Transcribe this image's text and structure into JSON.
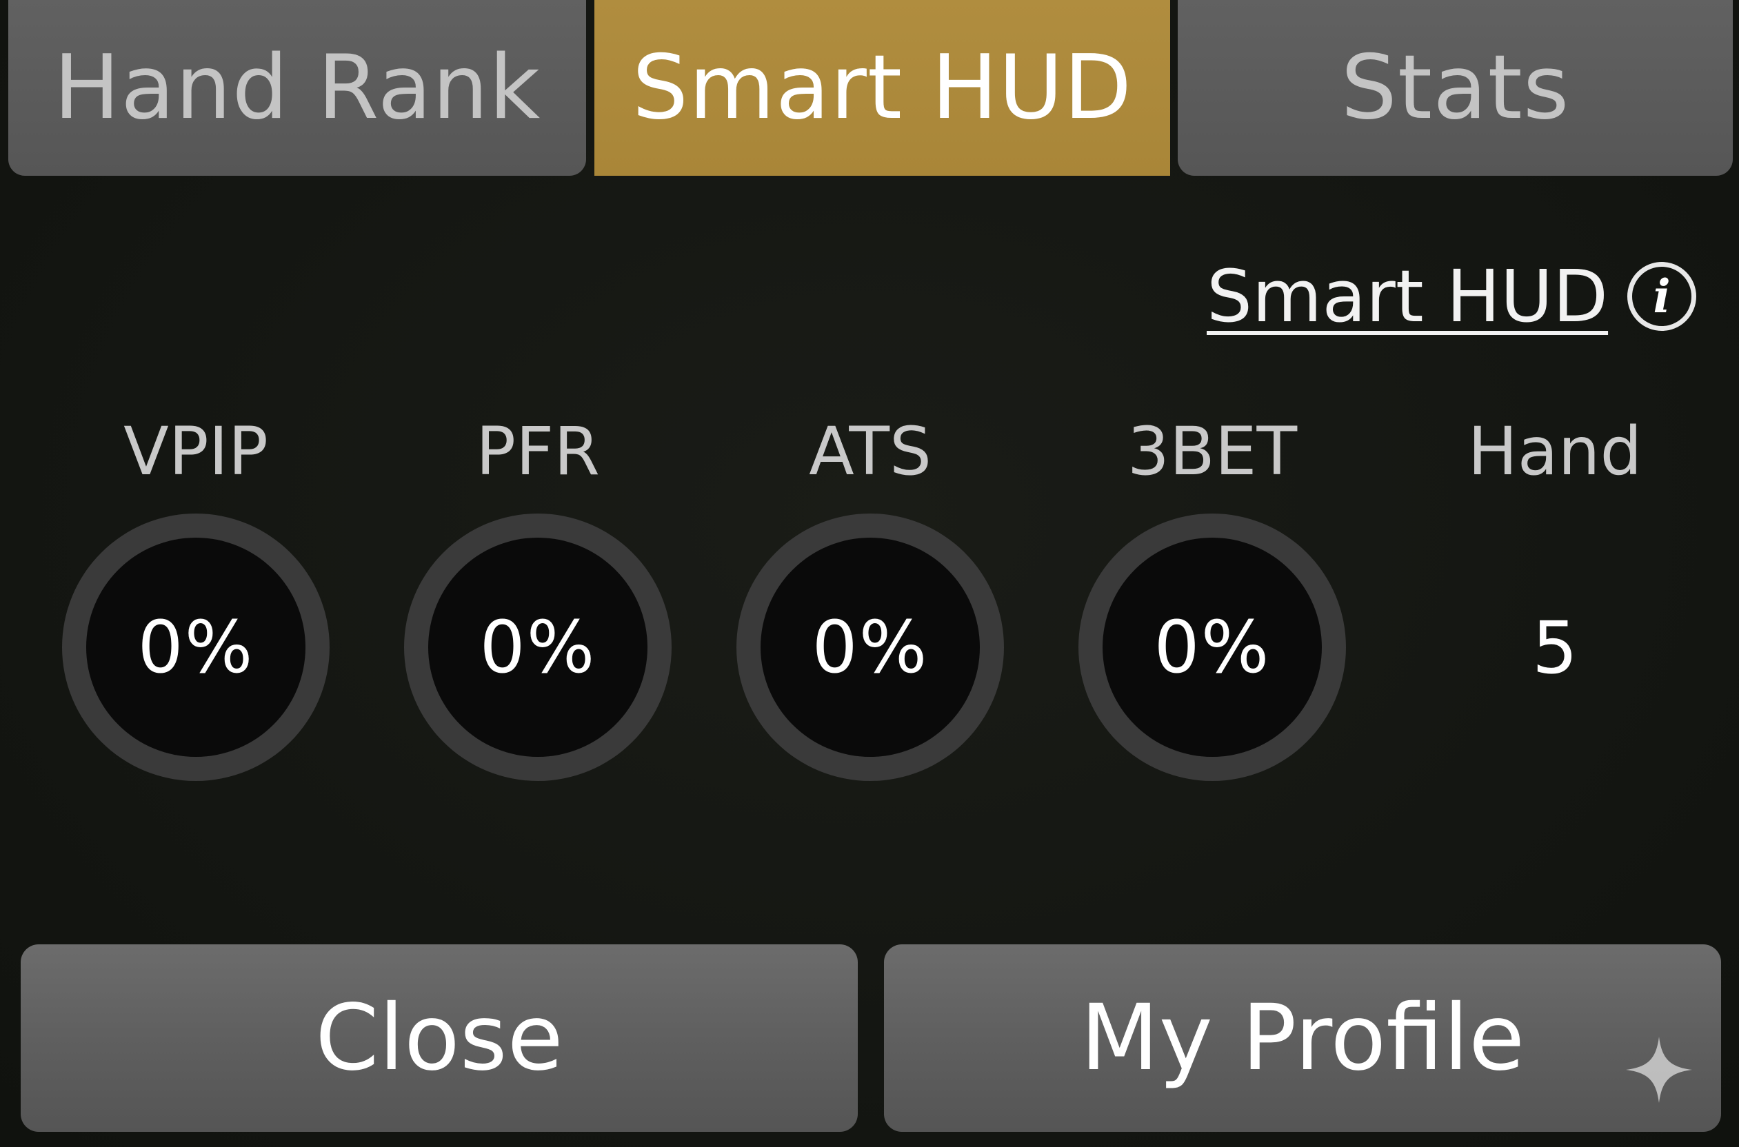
{
  "tabs": [
    {
      "label": "Hand Rank",
      "active": false
    },
    {
      "label": "Smart HUD",
      "active": true
    },
    {
      "label": "Stats",
      "active": false
    }
  ],
  "hud_link": {
    "label": "Smart HUD",
    "icon": "info-icon"
  },
  "stats": [
    {
      "label": "VPIP",
      "value": "0%"
    },
    {
      "label": "PFR",
      "value": "0%"
    },
    {
      "label": "ATS",
      "value": "0%"
    },
    {
      "label": "3BET",
      "value": "0%"
    }
  ],
  "hand": {
    "label": "Hand",
    "value": "5"
  },
  "buttons": {
    "close": "Close",
    "profile": "My Profile"
  },
  "colors": {
    "active_tab": "#b08d3f",
    "inactive_tab": "#5c5c5c",
    "background": "#141612",
    "ring": "#3a3a3a"
  }
}
